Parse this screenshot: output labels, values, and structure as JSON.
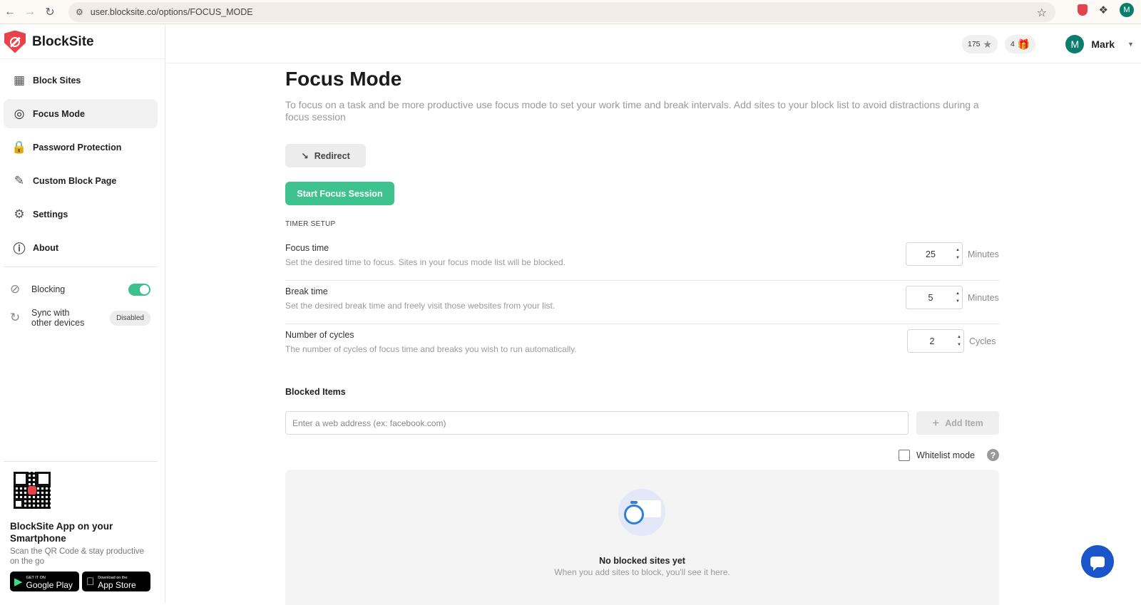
{
  "browser": {
    "url": "user.blocksite.co/options/FOCUS_MODE",
    "profile_initial": "M"
  },
  "brand": {
    "name": "BlockSite",
    "color": "#e8424b"
  },
  "sidebar": {
    "items": [
      {
        "label": "Block Sites",
        "icon": "grid-block-icon"
      },
      {
        "label": "Focus Mode",
        "icon": "target-icon",
        "active": true
      },
      {
        "label": "Password Protection",
        "icon": "lock-icon"
      },
      {
        "label": "Custom Block Page",
        "icon": "edit-page-icon"
      },
      {
        "label": "Settings",
        "icon": "gear-icon"
      },
      {
        "label": "About",
        "icon": "info-icon"
      }
    ],
    "blocking_label": "Blocking",
    "blocking_on": true,
    "sync_label_line1": "Sync with",
    "sync_label_line2": "other devices",
    "sync_status": "Disabled",
    "app_title": "BlockSite App on your Smartphone",
    "app_sub": "Scan the QR Code & stay productive on the go",
    "google_small": "GET IT ON",
    "google_big": "Google Play",
    "apple_small": "Download on the",
    "apple_big": "App Store"
  },
  "header": {
    "points": "175",
    "gifts": "4",
    "user_initial": "M",
    "user_name": "Mark"
  },
  "main": {
    "title": "Focus Mode",
    "description": "To focus on a task and be more productive use focus mode to set your work time and break intervals. Add sites to your block list to avoid distractions during a focus session",
    "redirect_label": "Redirect",
    "start_label": "Start Focus Session",
    "timer_section": "TIMER SETUP",
    "timers": [
      {
        "name": "Focus time",
        "desc": "Set the desired time to focus. Sites in your focus mode list will be blocked.",
        "value": "25",
        "unit": "Minutes"
      },
      {
        "name": "Break time",
        "desc": "Set the desired break time and freely visit those websites from your list.",
        "value": "5",
        "unit": "Minutes"
      },
      {
        "name": "Number of cycles",
        "desc": "The number of cycles of focus time and breaks you wish to run automatically.",
        "value": "2",
        "unit": "Cycles"
      }
    ],
    "blocked_title": "Blocked Items",
    "input_placeholder": "Enter a web address (ex: facebook.com)",
    "add_label": "Add Item",
    "whitelist_label": "Whitelist mode",
    "empty_title": "No blocked sites yet",
    "empty_sub": "When you add sites to block, you'll see it here."
  },
  "colors": {
    "accent": "#3ec38f",
    "chat": "#1a56c9",
    "avatar": "#0a7d6c"
  }
}
